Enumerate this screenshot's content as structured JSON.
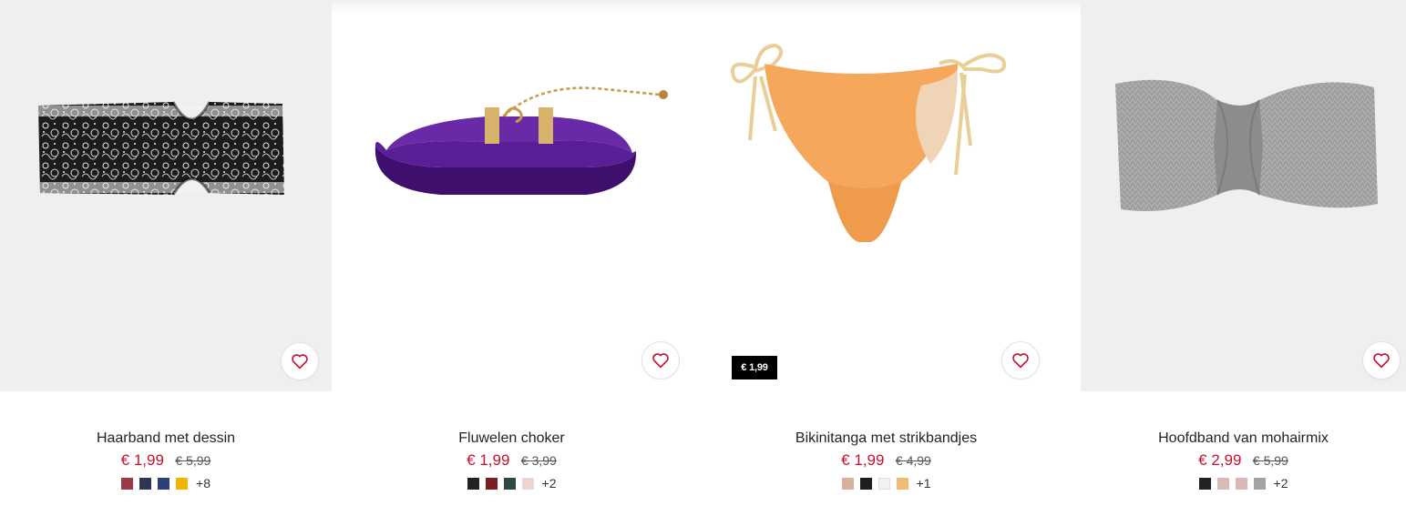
{
  "products": [
    {
      "name": "Haarband met dessin",
      "price": "€ 1,99",
      "old_price": "€ 5,99",
      "swatches": [
        "#9b3b45",
        "#2f3552",
        "#2d3f7a",
        "#f1b400"
      ],
      "more_colors": "+8",
      "favorite_icon": "heart-icon"
    },
    {
      "name": "Fluwelen choker",
      "price": "€ 1,99",
      "old_price": "€ 3,99",
      "swatches": [
        "#222222",
        "#7a1f22",
        "#2b4a40",
        "#efd3cf"
      ],
      "more_colors": "+2",
      "favorite_icon": "heart-icon"
    },
    {
      "name": "Bikinitanga met strikbandjes",
      "price": "€ 1,99",
      "old_price": "€ 4,99",
      "badge": "€ 1,99",
      "swatches": [
        "#d8b0a0",
        "#1e1e1e",
        "#f1f1f1",
        "#f0bb75"
      ],
      "more_colors": "+1",
      "favorite_icon": "heart-icon"
    },
    {
      "name": "Hoofdband van mohairmix",
      "price": "€ 2,99",
      "old_price": "€ 5,99",
      "swatches": [
        "#222222",
        "#d8bcb3",
        "#d9b8b6",
        "#a3a3a3"
      ],
      "more_colors": "+2",
      "favorite_icon": "heart-icon"
    }
  ],
  "colors": {
    "sale": "#c8102e",
    "heart": "#c8102e",
    "grey_bg": "#efefef"
  }
}
